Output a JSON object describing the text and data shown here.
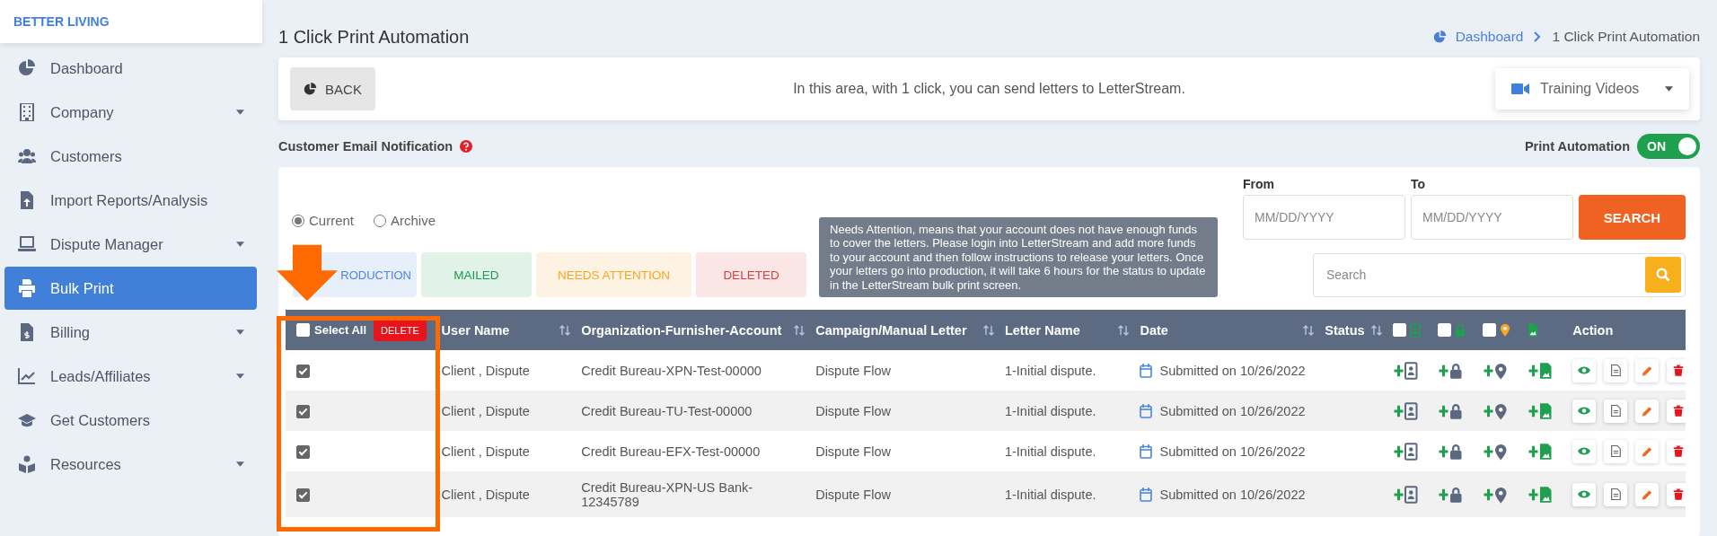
{
  "sidebar": {
    "brand": "BETTER LIVING",
    "items": [
      {
        "label": "Dashboard",
        "expandable": false,
        "selected": false
      },
      {
        "label": "Company",
        "expandable": true,
        "selected": false
      },
      {
        "label": "Customers",
        "expandable": false,
        "selected": false
      },
      {
        "label": "Import Reports/Analysis",
        "expandable": false,
        "selected": false
      },
      {
        "label": "Dispute Manager",
        "expandable": true,
        "selected": false
      },
      {
        "label": "Bulk Print",
        "expandable": false,
        "selected": true
      },
      {
        "label": "Billing",
        "expandable": true,
        "selected": false
      },
      {
        "label": "Leads/Affiliates",
        "expandable": true,
        "selected": false
      },
      {
        "label": "Get Customers",
        "expandable": false,
        "selected": false
      },
      {
        "label": "Resources",
        "expandable": true,
        "selected": false
      }
    ]
  },
  "page_title": "1 Click Print Automation",
  "breadcrumb": [
    {
      "label": "Dashboard"
    },
    {
      "label": "1 Click Print Automation"
    }
  ],
  "info_bar": {
    "back_button": "BACK",
    "message": "In this area, with 1 click, you can send letters to LetterStream.",
    "training_dropdown": "Training Videos"
  },
  "email_notification": {
    "label": "Customer Email Notification"
  },
  "print_automation": {
    "label": "Print Automation",
    "on": true,
    "state_text": "ON"
  },
  "filters": {
    "radios": [
      {
        "label": "Current",
        "selected": true
      },
      {
        "label": "Archive",
        "selected": false
      }
    ],
    "from": {
      "label": "From",
      "placeholder": "MM/DD/YYYY"
    },
    "to": {
      "label": "To",
      "placeholder": "MM/DD/YYYY"
    },
    "search_button": "SEARCH",
    "search": {
      "placeholder": "Search"
    }
  },
  "status_tabs": [
    {
      "label": "RODUCTION",
      "color": "#4a86e0"
    },
    {
      "label": "MAILED",
      "color": "#1e9a50"
    },
    {
      "label": "NEEDS ATTENTION",
      "color": "#f5a623"
    },
    {
      "label": "DELETED",
      "color": "#d9413c"
    }
  ],
  "tooltip": {
    "text": "Needs Attention, means that your account does not have enough funds to cover the letters. Please login into LetterStream and add more funds to your account and then follow instructions to release your letters. Once your letters go into production, it will take 6 hours for the status to update in the LetterStream bulk print screen."
  },
  "table": {
    "select_all": {
      "label": "Select All",
      "checked": false
    },
    "delete_button": "DELETE",
    "columns": [
      "User Name",
      "Organization-Furnisher-Account",
      "Campaign/Manual Letter",
      "Letter Name",
      "Date",
      "Status"
    ],
    "icon_columns": [
      {
        "checked": false
      },
      {
        "checked": false
      },
      {
        "checked": false
      }
    ],
    "action_column": "Action",
    "rows": [
      {
        "checked": true,
        "user_name": "Client , Dispute",
        "account": "Credit Bureau-XPN-Test-00000",
        "campaign": "Dispute Flow",
        "letter_name": "1-Initial dispute.",
        "date": "Submitted on 10/26/2022"
      },
      {
        "checked": true,
        "user_name": "Client , Dispute",
        "account": "Credit Bureau-TU-Test-00000",
        "campaign": "Dispute Flow",
        "letter_name": "1-Initial dispute.",
        "date": "Submitted on 10/26/2022"
      },
      {
        "checked": true,
        "user_name": "Client , Dispute",
        "account": "Credit Bureau-EFX-Test-00000",
        "campaign": "Dispute Flow",
        "letter_name": "1-Initial dispute.",
        "date": "Submitted on 10/26/2022"
      },
      {
        "checked": true,
        "user_name": "Client , Dispute",
        "account": "Credit Bureau-XPN-US Bank-12345789",
        "campaign": "Dispute Flow",
        "letter_name": "1-Initial dispute.",
        "date": "Submitted on 10/26/2022"
      }
    ]
  }
}
